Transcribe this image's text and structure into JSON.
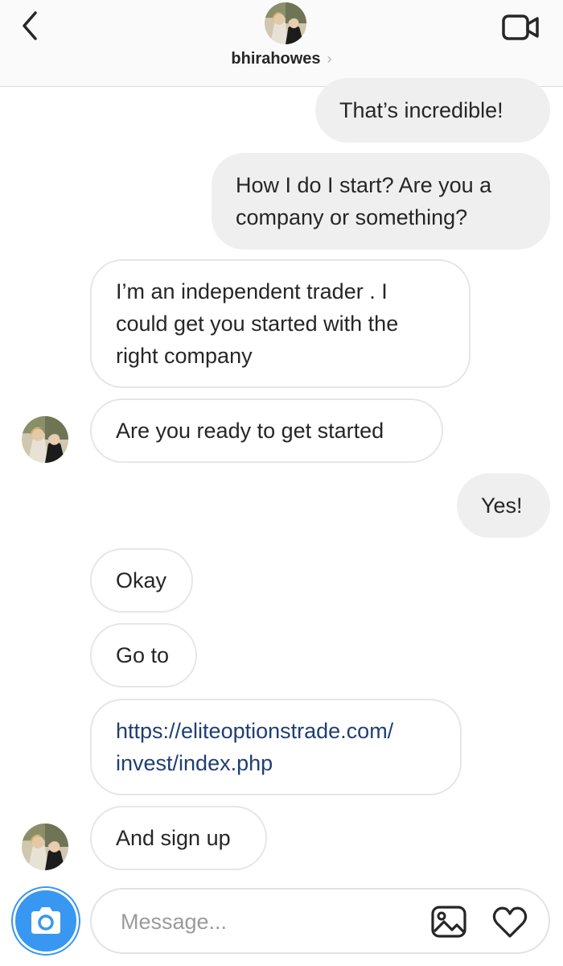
{
  "header": {
    "username": "bhirahowes",
    "chevron": "›",
    "icons": {
      "back": "chevron-left-icon",
      "video": "video-camera-icon"
    }
  },
  "messages": [
    {
      "id": "m1",
      "direction": "outgoing",
      "text": "That’s incredible!"
    },
    {
      "id": "m2",
      "direction": "outgoing",
      "text": "How I do I start? Are you a\ncompany or something?"
    },
    {
      "id": "m3",
      "direction": "incoming",
      "text": "I’m an independent trader . I\ncould get you started with the\nright company"
    },
    {
      "id": "m4",
      "direction": "incoming",
      "text": "Are you ready to get started"
    },
    {
      "id": "m5",
      "direction": "outgoing",
      "text": "Yes!"
    },
    {
      "id": "m6",
      "direction": "incoming",
      "text": "Okay"
    },
    {
      "id": "m7",
      "direction": "incoming",
      "text": "Go to"
    },
    {
      "id": "m8",
      "direction": "incoming",
      "text": "https://eliteoptionstrade.com/\ninvest/index.php",
      "is_link": true
    },
    {
      "id": "m9",
      "direction": "incoming",
      "text": "And sign up"
    }
  ],
  "composer": {
    "placeholder": "Message...",
    "value": "",
    "icons": {
      "camera": "camera-icon",
      "gallery": "image-icon",
      "like": "heart-icon"
    }
  },
  "colors": {
    "outgoing_bubble": "#efefef",
    "incoming_border": "#e6e6e6",
    "link_text": "#1f3f73",
    "camera_button": "#3897f0",
    "header_bg": "#fafafa"
  }
}
